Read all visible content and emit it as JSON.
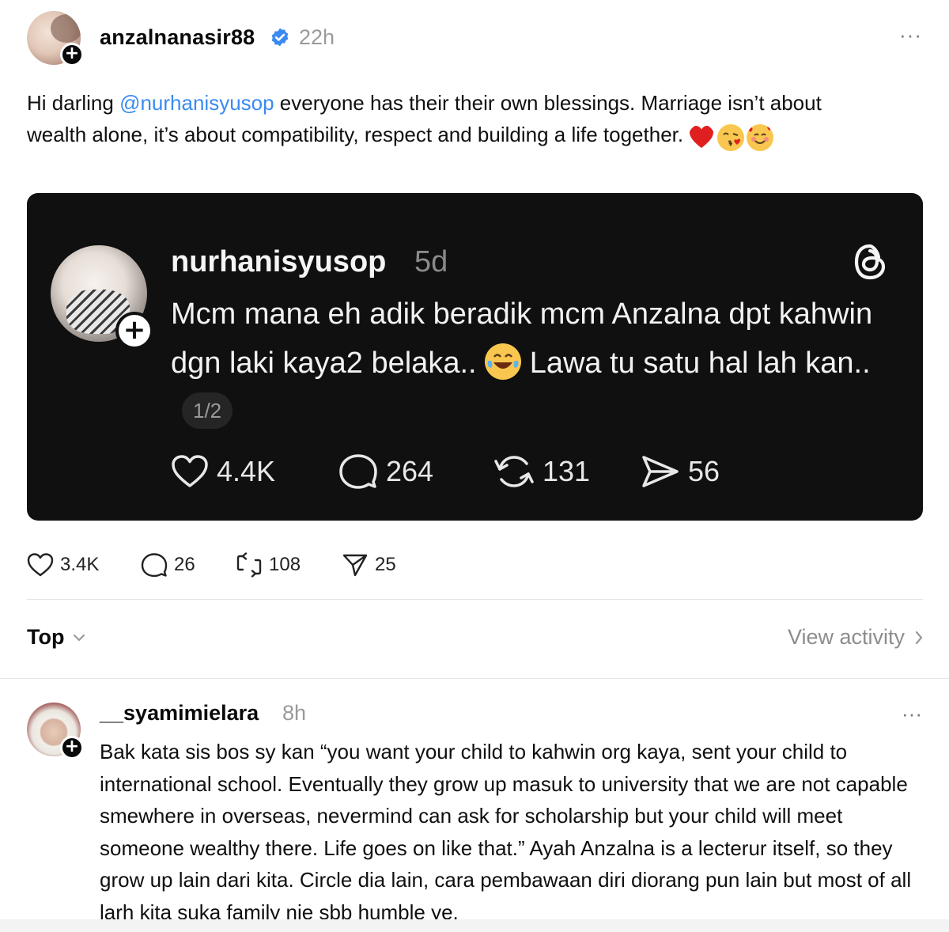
{
  "post": {
    "username": "anzalnanasir88",
    "time": "22h",
    "more": "···",
    "text_before": "Hi darling ",
    "mention": "@nurhanisyusop",
    "text_after": " everyone has their their own blessings. Marriage isn’t about wealth alone, it’s about compatibility, respect and building a life together.",
    "emojis": [
      "heart-emoji",
      "kissing-face-emoji",
      "smiling-face-with-hearts-emoji"
    ]
  },
  "embed": {
    "username": "nurhanisyusop",
    "time": "5d",
    "text_1": "Mcm mana eh adik beradik mcm Anzalna dpt kahwin dgn laki kaya2 belaka.. ",
    "text_2": " Lawa tu satu hal lah kan..",
    "pager": "1/2",
    "likes": "4.4K",
    "comments": "264",
    "reposts": "131",
    "shares": "56"
  },
  "stats": {
    "likes": "3.4K",
    "comments": "26",
    "reposts": "108",
    "shares": "25"
  },
  "sort": {
    "label": "Top",
    "view_activity": "View activity"
  },
  "comment": {
    "username": "__syamimielara",
    "time": "8h",
    "more": "···",
    "text": "Bak kata sis bos sy kan “you want your child to kahwin org kaya, sent your child to international school. Eventually they grow up masuk to university that we are not capable smewhere in overseas, nevermind can ask for scholarship but your child will meet someone wealthy there. Life goes on like that.” Ayah Anzalna is a lecterur itself, so they grow up lain dari kita. Circle dia lain, cara pembawaan diri diorang pun lain but most of all larh kita suka family nie sbb humble ye."
  },
  "colors": {
    "mention": "#3b8af0",
    "verified": "#3b8af0",
    "embed_bg": "#101010",
    "muted": "#9a9a9a"
  }
}
